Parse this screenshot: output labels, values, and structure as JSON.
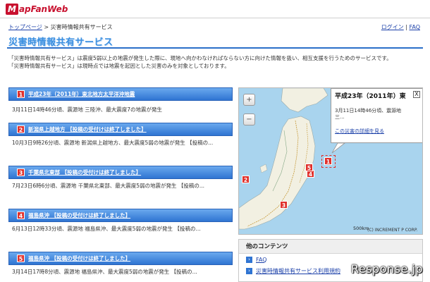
{
  "header": {
    "logo_mark": "M",
    "logo_text": "apFanWeb"
  },
  "breadcrumb": {
    "home": "トップページ",
    "separator": " > ",
    "current": "災害時情報共有サービス"
  },
  "topnav": {
    "login": "ログイン",
    "separator": " | ",
    "faq": "FAQ"
  },
  "page_title": "災害時情報共有サービス",
  "intro": [
    "「災害時情報共有サービス」は震度5弱以上の地震が発生した際に、現地へ向かわなければならない方に向けた情報を扱い、相互支援を行うためのサービスです。",
    "「災害時情報共有サービス」は現時点では地震を起因とした災害のみを対象としております。"
  ],
  "list": [
    {
      "num": "1",
      "title": "平成23年（2011年）東北地方太平洋沖地震",
      "desc": "3月11日14時46分頃、震源地 三陸沖、最大震度7の地震が発生"
    },
    {
      "num": "2",
      "title": "新潟県上越地方 【投稿の受付けは終了しました】",
      "desc": "10月3日9時26分頃、震源地 新潟県上越地方、最大震度5弱の地震が発生 【投稿の..."
    },
    {
      "num": "3",
      "title": "千葉県北東部 【投稿の受付けは終了しました】",
      "desc": "7月23日6時6分頃、震源地 千葉県北東部、最大震度5弱の地震が発生 【投稿の..."
    },
    {
      "num": "4",
      "title": "福島県沖 【投稿の受付けは終了しました】",
      "desc": "6月13日12時33分頃、震源地 福島県沖、最大震度5弱の地震が発生 【投稿の..."
    },
    {
      "num": "5",
      "title": "福島県沖 【投稿の受付けは終了しました】",
      "desc": "3月14日17時8分頃、震源地 福島県沖、最大震度5弱の地震が発生 【投稿の..."
    }
  ],
  "map": {
    "zoom_in": "+",
    "zoom_out": "−",
    "popup_title": "平成23年（2011年）東",
    "popup_close": "X",
    "popup_line": "3月11日14時46分頃、震源地",
    "popup_line2": "三...",
    "popup_link": "この災害の詳細を見る",
    "markers": [
      "1",
      "2",
      "3",
      "4",
      "5"
    ],
    "scale": "500km",
    "copyright": "(C) INCREMENT P CORP."
  },
  "other": {
    "title": "他のコンテンツ",
    "links": [
      "FAQ",
      "災害時情報共有サービス利用規約"
    ]
  },
  "watermark": "Response.jp",
  "colors": {
    "accent": "#2f74d2",
    "marker": "#e0312c",
    "brand": "#c8102e",
    "sea": "#a9d4ee",
    "land": "#f2f0e2"
  }
}
